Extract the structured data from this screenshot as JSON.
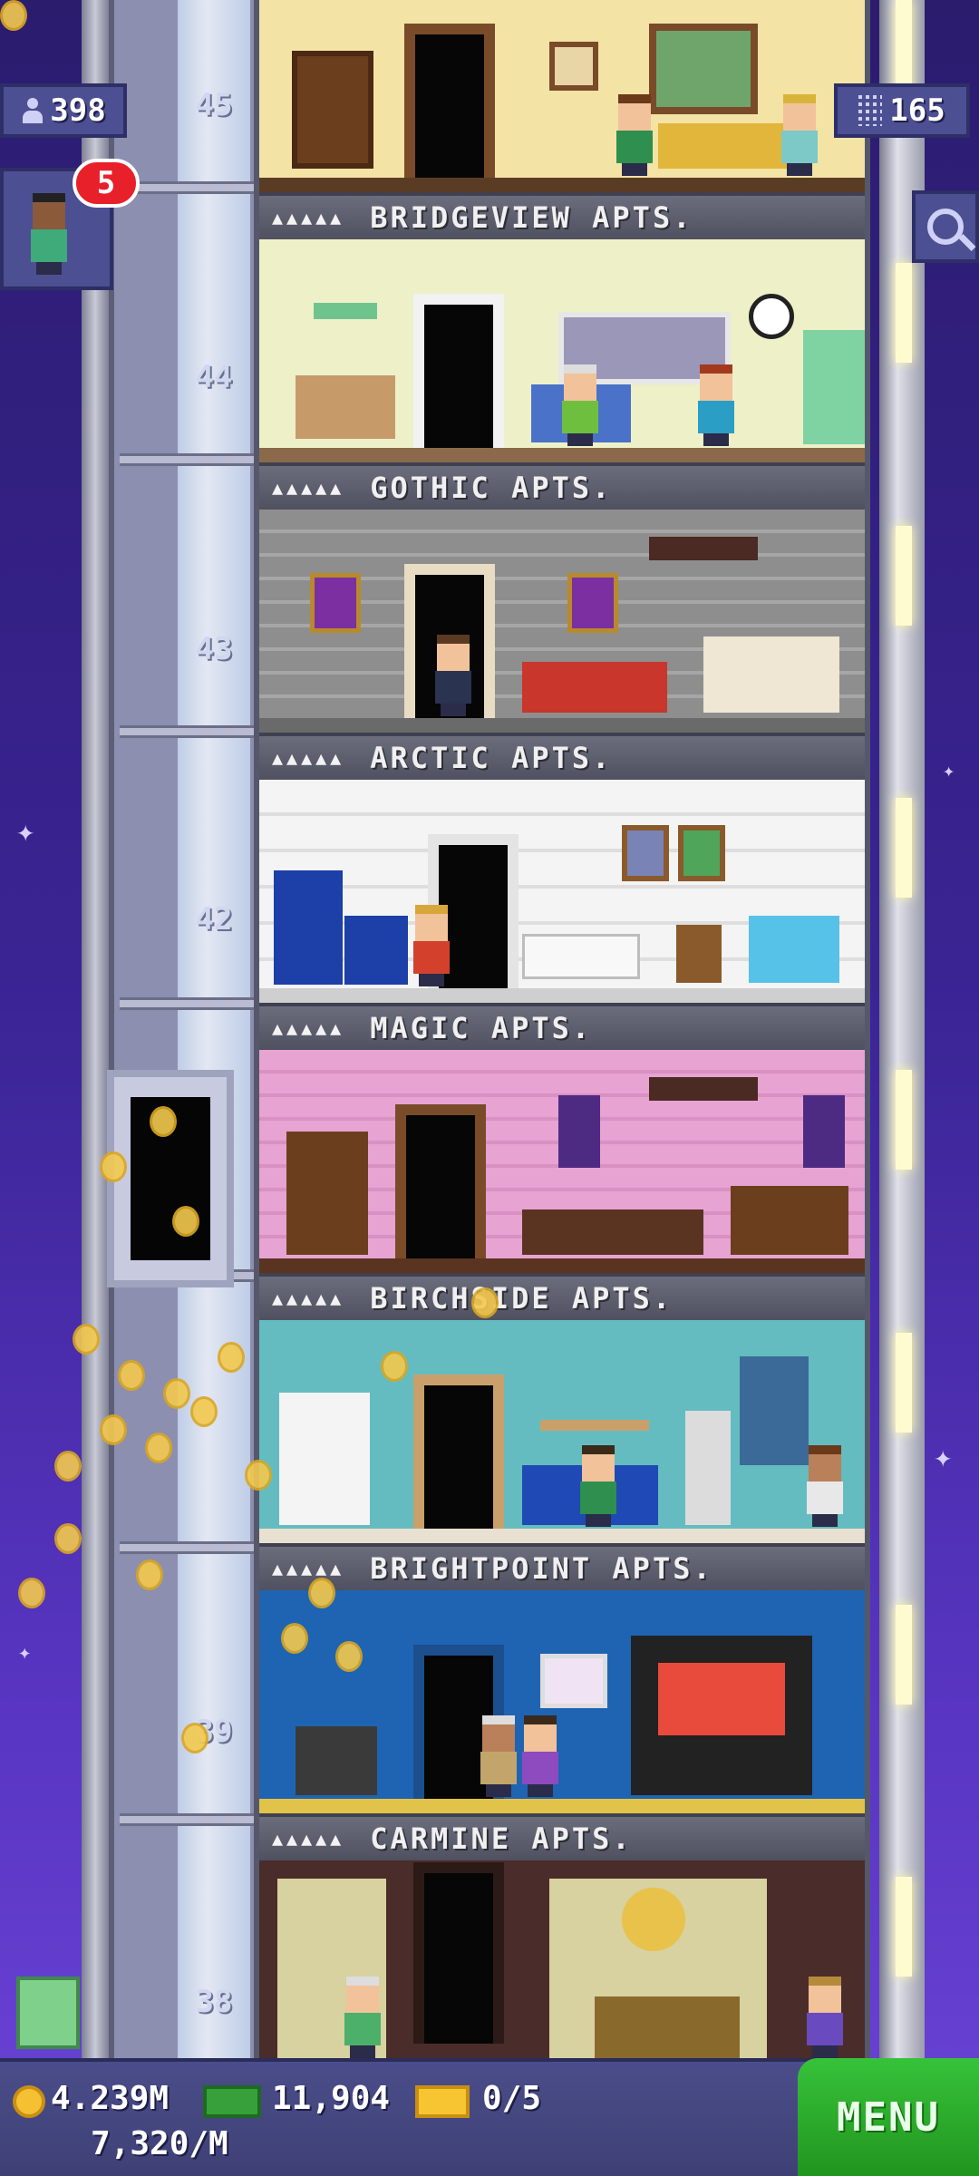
{
  "hud": {
    "population": "398",
    "floors_count": "165",
    "visitor_badge": "5",
    "coins": "4.239M",
    "coins_rate": "7,320/M",
    "bux": "11,904",
    "tickets": "0/5",
    "menu_label": "MENU"
  },
  "floor_numbers": {
    "f45": "45",
    "f44": "44",
    "f43": "43",
    "f42": "42",
    "f39": "39",
    "f38": "38"
  },
  "floors": [
    {
      "name": "BRIDGEVIEW APTS.",
      "stars": "▲▲▲▲▲"
    },
    {
      "name": "GOTHIC APTS.",
      "stars": "▲▲▲▲▲"
    },
    {
      "name": "ARCTIC APTS.",
      "stars": "▲▲▲▲▲"
    },
    {
      "name": "MAGIC APTS.",
      "stars": "▲▲▲▲▲"
    },
    {
      "name": "BIRCHSIDE APTS.",
      "stars": "▲▲▲▲▲"
    },
    {
      "name": "BRIGHTPOINT APTS.",
      "stars": "▲▲▲▲▲"
    },
    {
      "name": "CARMINE APTS.",
      "stars": "▲▲▲▲▲"
    }
  ],
  "colors": {
    "sky_top": "#2b1c6e",
    "sky_bottom": "#6a44d6",
    "hud_panel": "#4d4f93",
    "menu_green": "#21951f",
    "badge_red": "#e8202a",
    "coin_gold": "#f5c031"
  },
  "icons": {
    "population": "person-icon",
    "floors": "building-icon",
    "search": "magnifier-icon",
    "coins": "coin-icon",
    "bux": "bux-icon",
    "tickets": "ticket-icon",
    "gift": "gift-icon"
  }
}
